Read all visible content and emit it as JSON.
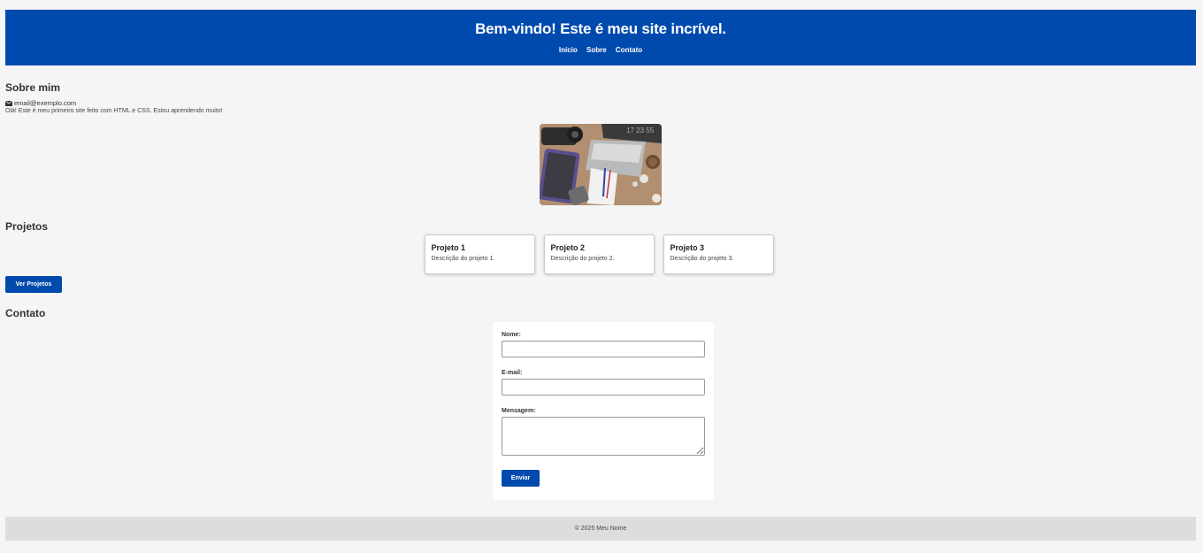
{
  "header": {
    "title": "Bem-vindo! Este é meu site incrível.",
    "nav": [
      "Início",
      "Sobre",
      "Contato"
    ]
  },
  "about": {
    "heading": "Sobre mim",
    "email_icon": "envelope-icon",
    "email": "email@exemplo.com",
    "intro": "Olá! Este é meu primeiro site feito com HTML e CSS. Estou aprendendo muito!",
    "image_description": "desk-photo"
  },
  "projects": {
    "heading": "Projetos",
    "items": [
      {
        "title": "Projeto 1",
        "description": "Descrição do projeto 1."
      },
      {
        "title": "Projeto 2",
        "description": "Descrição do projeto 2."
      },
      {
        "title": "Projeto 3",
        "description": "Descrição do projeto 3."
      }
    ],
    "button_label": "Ver Projetos"
  },
  "contact": {
    "heading": "Contato",
    "name_label": "Nome:",
    "name_value": "",
    "email_label": "E-mail:",
    "email_value": "",
    "message_label": "Mensagem:",
    "message_value": "",
    "submit_label": "Enviar"
  },
  "footer": {
    "text": "© 2025 Meu Nome"
  },
  "colors": {
    "primary": "#004aad",
    "background": "#f5f5f5",
    "footer": "#dddddd"
  }
}
